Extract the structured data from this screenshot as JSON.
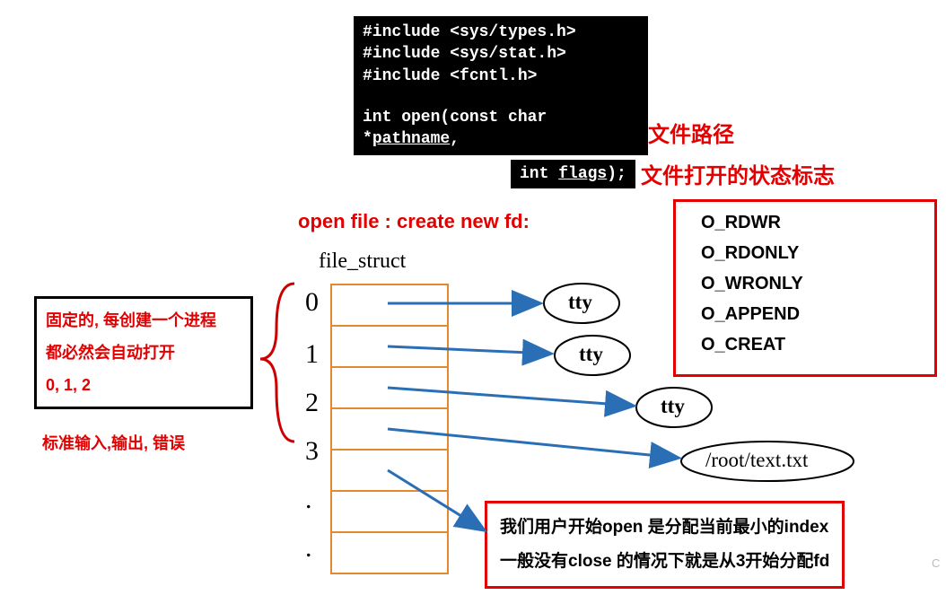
{
  "code": {
    "l1": "#include <sys/types.h>",
    "l2": "#include <sys/stat.h>",
    "l3": "#include <fcntl.h>",
    "fn1a": "int open(const char *",
    "fn1b": "pathname",
    "fn1c": ",",
    "fn2a": "int ",
    "fn2b": "flags",
    "fn2c": ");"
  },
  "ann": {
    "pathname": "文件路径",
    "flags": "文件打开的状态标志",
    "open_title": "open file : create new fd:",
    "struct_label": "file_struct",
    "left1": "固定的, 每创建一个进程",
    "left2": "都必然会自动打开",
    "left3": "0,   1,   2",
    "left4": "标准输入,输出, 错误",
    "bot1": "我们用户开始open 是分配当前最小的index",
    "bot2": "一般没有close 的情况下就是从3开始分配fd"
  },
  "flags": {
    "f1": "O_RDWR",
    "f2": "O_RDONLY",
    "f3": "O_WRONLY",
    "f4": "O_APPEND",
    "f5": "O_CREAT"
  },
  "fd": {
    "n0": "0",
    "n1": "1",
    "n2": "2",
    "n3": "3",
    "d1": ".",
    "d2": "."
  },
  "node": {
    "tty": "tty",
    "file": "/root/text.txt"
  },
  "wm": "C"
}
